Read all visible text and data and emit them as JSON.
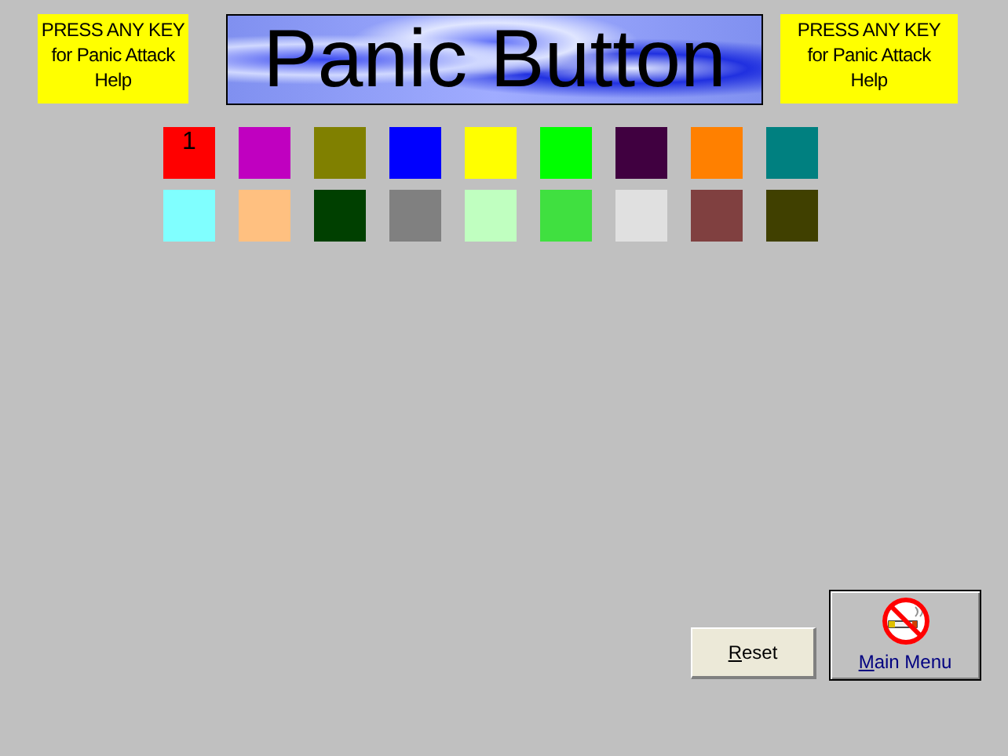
{
  "notices": [
    {
      "text": "PRESS ANY KEY for Panic Attack Help"
    },
    {
      "text": "PRESS ANY KEY for Panic Attack Help"
    }
  ],
  "banner": {
    "title": "Panic Button"
  },
  "swatches": [
    {
      "color": "#ff0000",
      "label": "1"
    },
    {
      "color": "#c000c0"
    },
    {
      "color": "#808000"
    },
    {
      "color": "#0000ff"
    },
    {
      "color": "#ffff00"
    },
    {
      "color": "#00ff00"
    },
    {
      "color": "#400040"
    },
    {
      "color": "#ff8000"
    },
    {
      "color": "#008080"
    },
    {
      "color": "#80ffff"
    },
    {
      "color": "#ffc080"
    },
    {
      "color": "#004000"
    },
    {
      "color": "#808080"
    },
    {
      "color": "#c0ffc0"
    },
    {
      "color": "#40e040"
    },
    {
      "color": "#e0e0e0"
    },
    {
      "color": "#804040"
    },
    {
      "color": "#404000"
    }
  ],
  "buttons": [
    {
      "kind": "plain",
      "key_letter": "R",
      "rest": "eset"
    },
    {
      "kind": "icon",
      "key_letter": "M",
      "rest": "ain Menu"
    }
  ]
}
